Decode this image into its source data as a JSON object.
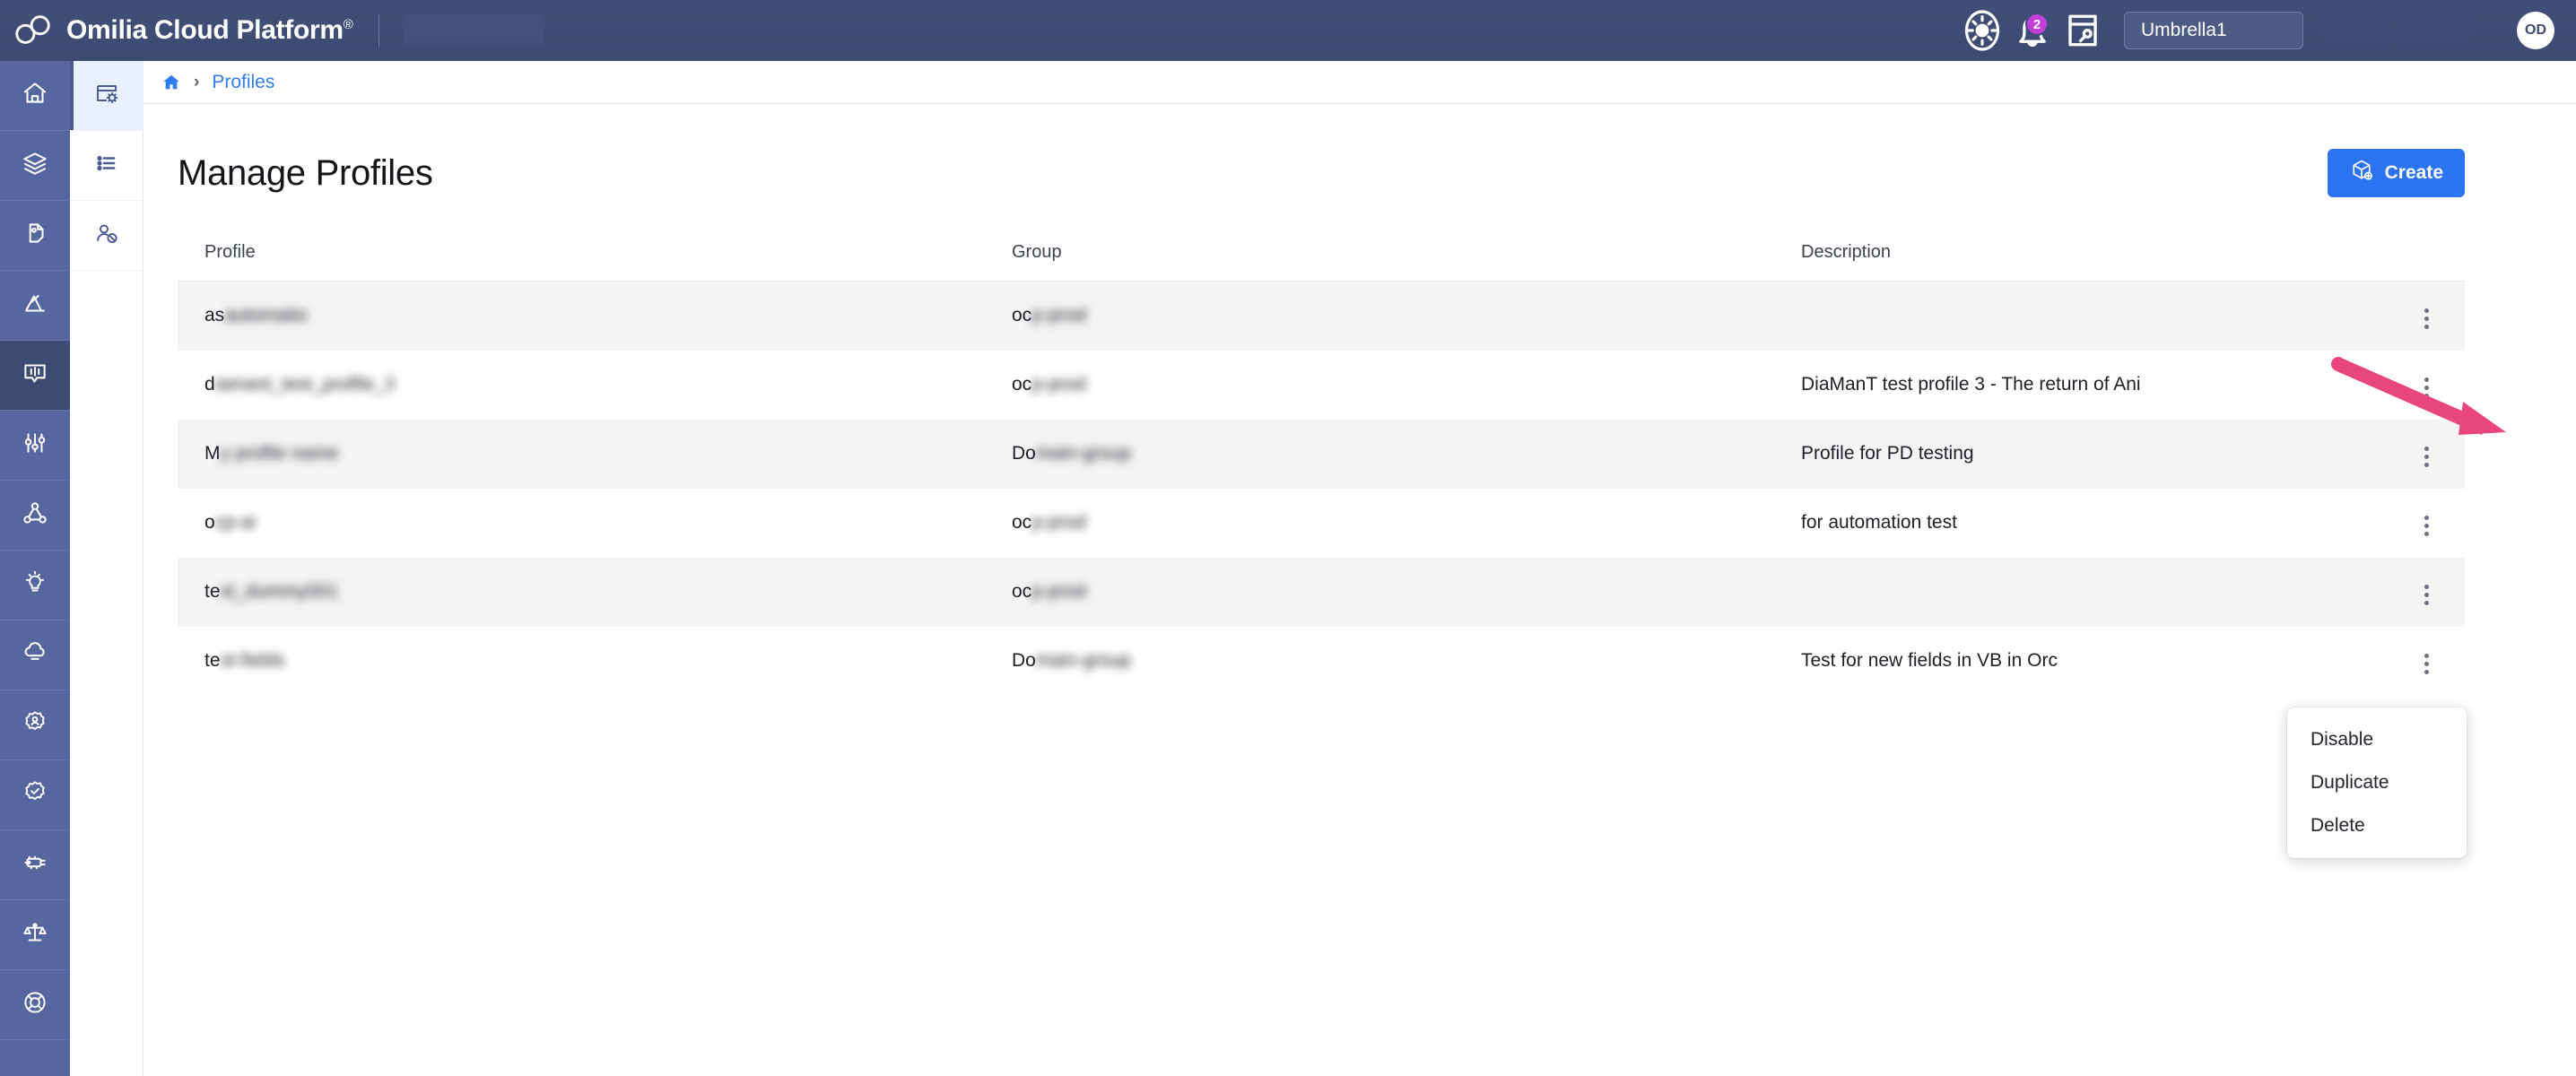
{
  "header": {
    "brand_title": "Omilia Cloud Platform",
    "brand_sup": "®",
    "notifications_badge": "2",
    "tenant": "Umbrella1",
    "avatar_initials": "OD",
    "icons": [
      "theme-sun-icon",
      "bell-icon",
      "note-edit-icon"
    ],
    "colors": {
      "bar_top": "#414f78",
      "bar_bottom": "#3d4a72",
      "badge": "#c13fd6"
    }
  },
  "sidebar": {
    "items": [
      {
        "name": "home",
        "icon": "home-icon",
        "active": false
      },
      {
        "name": "layers",
        "icon": "layers-icon",
        "active": false
      },
      {
        "name": "tag",
        "icon": "tag-icon",
        "active": false
      },
      {
        "name": "analytics",
        "icon": "analytics-chart-icon",
        "active": false
      },
      {
        "name": "dialog",
        "icon": "speech-bubble-icon",
        "active": true
      },
      {
        "name": "tuning",
        "icon": "sliders-icon",
        "active": false
      },
      {
        "name": "graph",
        "icon": "network-graph-icon",
        "active": false
      },
      {
        "name": "insights",
        "icon": "lightbulb-icon",
        "active": false
      },
      {
        "name": "cloud",
        "icon": "cloud-icon",
        "active": false
      },
      {
        "name": "admin",
        "icon": "gear-user-icon",
        "active": false
      },
      {
        "name": "security",
        "icon": "shield-check-icon",
        "active": false
      },
      {
        "name": "infrastructure",
        "icon": "server-chip-icon",
        "active": false
      },
      {
        "name": "compliance",
        "icon": "scales-icon",
        "active": false
      },
      {
        "name": "support",
        "icon": "lifebuoy-icon",
        "active": false
      }
    ]
  },
  "subnav": {
    "items": [
      {
        "name": "profiles",
        "icon": "window-gear-icon",
        "active": true
      },
      {
        "name": "lists",
        "icon": "list-icon",
        "active": false
      },
      {
        "name": "blocked-users",
        "icon": "person-blocked-icon",
        "active": false
      }
    ]
  },
  "breadcrumb": {
    "home_icon": "home-icon",
    "separator": "›",
    "current": "Profiles"
  },
  "page": {
    "title": "Manage Profiles",
    "create_label": "Create",
    "create_icon": "cube-plus-icon",
    "accent_blue": "#2b73f0"
  },
  "table": {
    "columns": [
      "Profile",
      "Group",
      "Description"
    ],
    "rows": [
      {
        "profile_visible": "as",
        "profile_redacted": "automatio",
        "group_visible": "oc",
        "group_redacted": "p-prod",
        "description": ""
      },
      {
        "profile_visible": "d",
        "profile_redacted": "iamant_test_profile_3",
        "group_visible": "oc",
        "group_redacted": "p-prod",
        "description": "DiaManT test profile 3 - The return of Ani"
      },
      {
        "profile_visible": "M",
        "profile_redacted": "y profile name",
        "group_visible": "Do",
        "group_redacted": "main-group",
        "description": "Profile for PD testing"
      },
      {
        "profile_visible": "o",
        "profile_redacted": "cp-ai",
        "group_visible": "oc",
        "group_redacted": "p-prod",
        "description": "for automation test"
      },
      {
        "profile_visible": "te",
        "profile_redacted": "st_dummy001",
        "group_visible": "oc",
        "group_redacted": "p-prod",
        "description": ""
      },
      {
        "profile_visible": "te",
        "profile_redacted": "st-fields",
        "group_visible": "Do",
        "group_redacted": "main-group",
        "description": "Test for new fields in VB in Orc"
      }
    ],
    "row_menu_icon": "kebab-menu-icon"
  },
  "context_menu": {
    "open_for_row": 2,
    "items": [
      "Disable",
      "Duplicate",
      "Delete"
    ]
  },
  "annotation": {
    "type": "arrow",
    "color": "#e8467c",
    "points_to": "row-2-kebab-menu"
  }
}
